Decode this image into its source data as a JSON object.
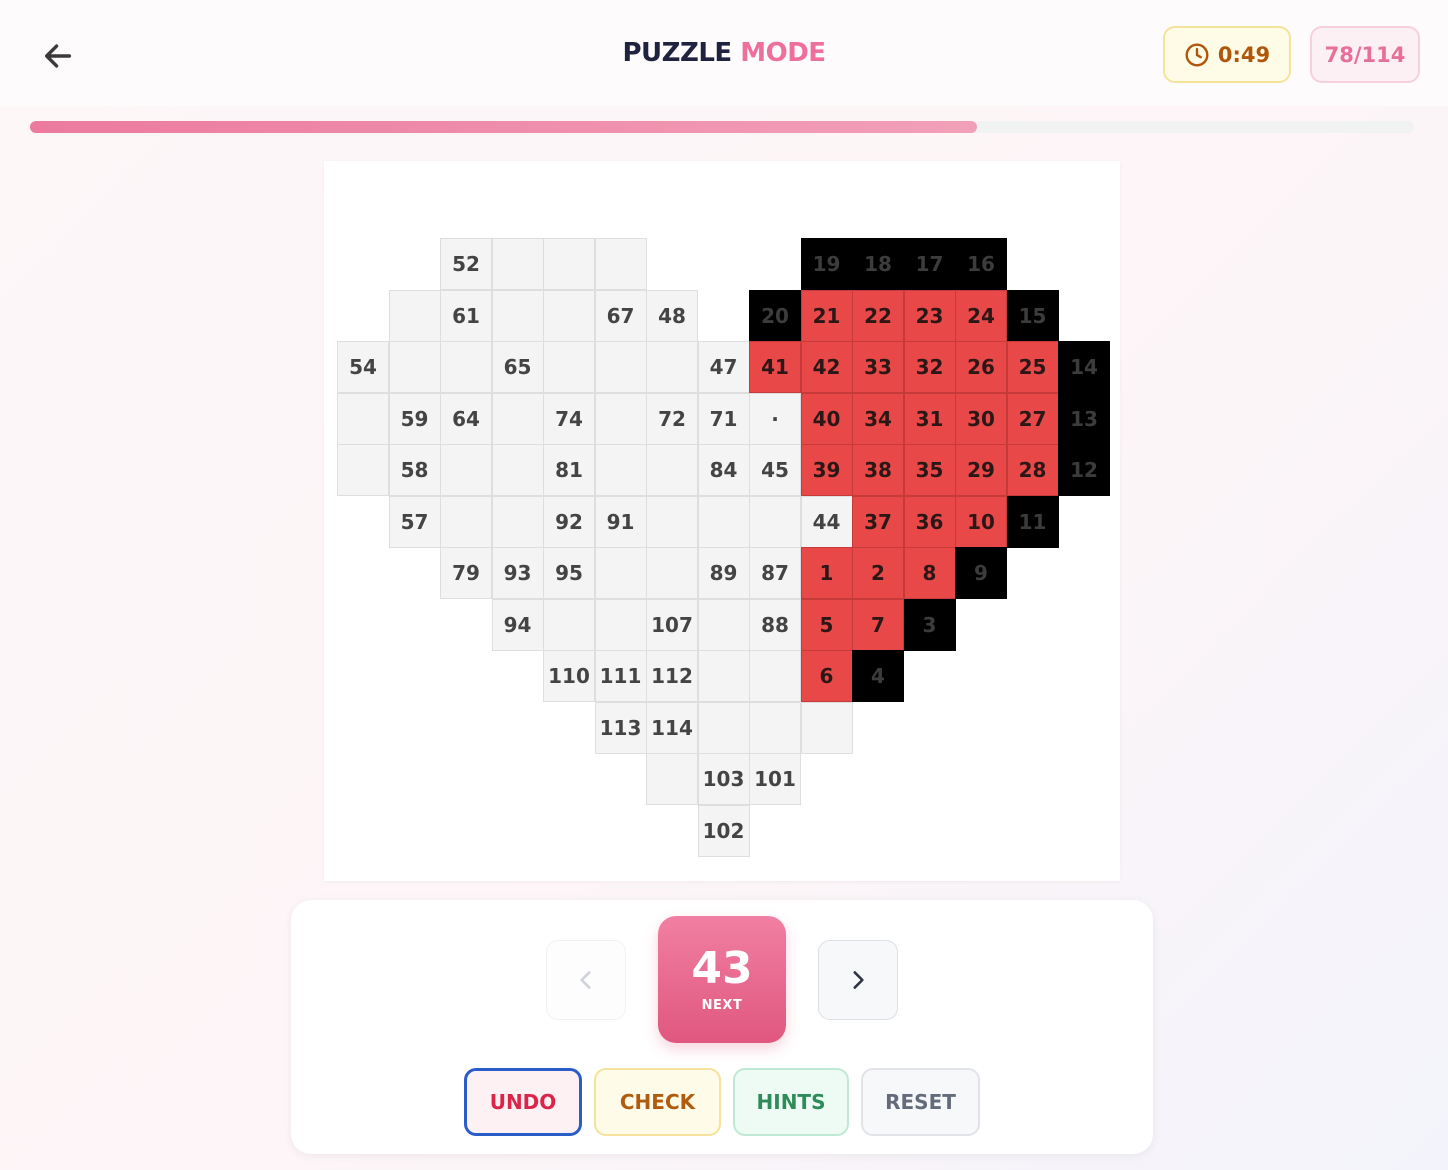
{
  "header": {
    "title_part1": "PUZZLE",
    "title_part2": "MODE",
    "timer": "0:49",
    "counter": "78/114",
    "progress_fraction": 0.684
  },
  "colors": {
    "red": "#e84848",
    "black": "#000000",
    "empty": "#f4f4f4",
    "accent": "#ee6f9b"
  },
  "board": {
    "cells": [
      {
        "r": 0,
        "c": 2,
        "t": "52",
        "s": "e"
      },
      {
        "r": 0,
        "c": 3,
        "t": "",
        "s": "e"
      },
      {
        "r": 0,
        "c": 4,
        "t": "",
        "s": "e"
      },
      {
        "r": 0,
        "c": 5,
        "t": "",
        "s": "e"
      },
      {
        "r": 0,
        "c": 9,
        "t": "19",
        "s": "b"
      },
      {
        "r": 0,
        "c": 10,
        "t": "18",
        "s": "b"
      },
      {
        "r": 0,
        "c": 11,
        "t": "17",
        "s": "b"
      },
      {
        "r": 0,
        "c": 12,
        "t": "16",
        "s": "b"
      },
      {
        "r": 1,
        "c": 1,
        "t": "",
        "s": "e"
      },
      {
        "r": 1,
        "c": 2,
        "t": "61",
        "s": "e"
      },
      {
        "r": 1,
        "c": 3,
        "t": "",
        "s": "e"
      },
      {
        "r": 1,
        "c": 4,
        "t": "",
        "s": "e"
      },
      {
        "r": 1,
        "c": 5,
        "t": "67",
        "s": "e"
      },
      {
        "r": 1,
        "c": 6,
        "t": "48",
        "s": "e"
      },
      {
        "r": 1,
        "c": 8,
        "t": "20",
        "s": "b"
      },
      {
        "r": 1,
        "c": 9,
        "t": "21",
        "s": "r"
      },
      {
        "r": 1,
        "c": 10,
        "t": "22",
        "s": "r"
      },
      {
        "r": 1,
        "c": 11,
        "t": "23",
        "s": "r"
      },
      {
        "r": 1,
        "c": 12,
        "t": "24",
        "s": "r"
      },
      {
        "r": 1,
        "c": 13,
        "t": "15",
        "s": "b"
      },
      {
        "r": 2,
        "c": 0,
        "t": "54",
        "s": "e"
      },
      {
        "r": 2,
        "c": 1,
        "t": "",
        "s": "e"
      },
      {
        "r": 2,
        "c": 2,
        "t": "",
        "s": "e"
      },
      {
        "r": 2,
        "c": 3,
        "t": "65",
        "s": "e"
      },
      {
        "r": 2,
        "c": 4,
        "t": "",
        "s": "e"
      },
      {
        "r": 2,
        "c": 5,
        "t": "",
        "s": "e"
      },
      {
        "r": 2,
        "c": 6,
        "t": "",
        "s": "e"
      },
      {
        "r": 2,
        "c": 7,
        "t": "47",
        "s": "e"
      },
      {
        "r": 2,
        "c": 8,
        "t": "41",
        "s": "r"
      },
      {
        "r": 2,
        "c": 9,
        "t": "42",
        "s": "r"
      },
      {
        "r": 2,
        "c": 10,
        "t": "33",
        "s": "r"
      },
      {
        "r": 2,
        "c": 11,
        "t": "32",
        "s": "r"
      },
      {
        "r": 2,
        "c": 12,
        "t": "26",
        "s": "r"
      },
      {
        "r": 2,
        "c": 13,
        "t": "25",
        "s": "r"
      },
      {
        "r": 2,
        "c": 14,
        "t": "14",
        "s": "b"
      },
      {
        "r": 3,
        "c": 0,
        "t": "",
        "s": "e"
      },
      {
        "r": 3,
        "c": 1,
        "t": "59",
        "s": "e"
      },
      {
        "r": 3,
        "c": 2,
        "t": "64",
        "s": "e"
      },
      {
        "r": 3,
        "c": 3,
        "t": "",
        "s": "e"
      },
      {
        "r": 3,
        "c": 4,
        "t": "74",
        "s": "e"
      },
      {
        "r": 3,
        "c": 5,
        "t": "",
        "s": "e"
      },
      {
        "r": 3,
        "c": 6,
        "t": "72",
        "s": "e"
      },
      {
        "r": 3,
        "c": 7,
        "t": "71",
        "s": "e"
      },
      {
        "r": 3,
        "c": 8,
        "t": "·",
        "s": "e"
      },
      {
        "r": 3,
        "c": 9,
        "t": "40",
        "s": "r"
      },
      {
        "r": 3,
        "c": 10,
        "t": "34",
        "s": "r"
      },
      {
        "r": 3,
        "c": 11,
        "t": "31",
        "s": "r"
      },
      {
        "r": 3,
        "c": 12,
        "t": "30",
        "s": "r"
      },
      {
        "r": 3,
        "c": 13,
        "t": "27",
        "s": "r"
      },
      {
        "r": 3,
        "c": 14,
        "t": "13",
        "s": "b"
      },
      {
        "r": 4,
        "c": 0,
        "t": "",
        "s": "e"
      },
      {
        "r": 4,
        "c": 1,
        "t": "58",
        "s": "e"
      },
      {
        "r": 4,
        "c": 2,
        "t": "",
        "s": "e"
      },
      {
        "r": 4,
        "c": 3,
        "t": "",
        "s": "e"
      },
      {
        "r": 4,
        "c": 4,
        "t": "81",
        "s": "e"
      },
      {
        "r": 4,
        "c": 5,
        "t": "",
        "s": "e"
      },
      {
        "r": 4,
        "c": 6,
        "t": "",
        "s": "e"
      },
      {
        "r": 4,
        "c": 7,
        "t": "84",
        "s": "e"
      },
      {
        "r": 4,
        "c": 8,
        "t": "45",
        "s": "e"
      },
      {
        "r": 4,
        "c": 9,
        "t": "39",
        "s": "r"
      },
      {
        "r": 4,
        "c": 10,
        "t": "38",
        "s": "r"
      },
      {
        "r": 4,
        "c": 11,
        "t": "35",
        "s": "r"
      },
      {
        "r": 4,
        "c": 12,
        "t": "29",
        "s": "r"
      },
      {
        "r": 4,
        "c": 13,
        "t": "28",
        "s": "r"
      },
      {
        "r": 4,
        "c": 14,
        "t": "12",
        "s": "b"
      },
      {
        "r": 5,
        "c": 1,
        "t": "57",
        "s": "e"
      },
      {
        "r": 5,
        "c": 2,
        "t": "",
        "s": "e"
      },
      {
        "r": 5,
        "c": 3,
        "t": "",
        "s": "e"
      },
      {
        "r": 5,
        "c": 4,
        "t": "92",
        "s": "e"
      },
      {
        "r": 5,
        "c": 5,
        "t": "91",
        "s": "e"
      },
      {
        "r": 5,
        "c": 6,
        "t": "",
        "s": "e"
      },
      {
        "r": 5,
        "c": 7,
        "t": "",
        "s": "e"
      },
      {
        "r": 5,
        "c": 8,
        "t": "",
        "s": "e"
      },
      {
        "r": 5,
        "c": 9,
        "t": "44",
        "s": "e"
      },
      {
        "r": 5,
        "c": 10,
        "t": "37",
        "s": "r"
      },
      {
        "r": 5,
        "c": 11,
        "t": "36",
        "s": "r"
      },
      {
        "r": 5,
        "c": 12,
        "t": "10",
        "s": "r"
      },
      {
        "r": 5,
        "c": 13,
        "t": "11",
        "s": "b"
      },
      {
        "r": 6,
        "c": 2,
        "t": "79",
        "s": "e"
      },
      {
        "r": 6,
        "c": 3,
        "t": "93",
        "s": "e"
      },
      {
        "r": 6,
        "c": 4,
        "t": "95",
        "s": "e"
      },
      {
        "r": 6,
        "c": 5,
        "t": "",
        "s": "e"
      },
      {
        "r": 6,
        "c": 6,
        "t": "",
        "s": "e"
      },
      {
        "r": 6,
        "c": 7,
        "t": "89",
        "s": "e"
      },
      {
        "r": 6,
        "c": 8,
        "t": "87",
        "s": "e"
      },
      {
        "r": 6,
        "c": 9,
        "t": "1",
        "s": "r"
      },
      {
        "r": 6,
        "c": 10,
        "t": "2",
        "s": "r"
      },
      {
        "r": 6,
        "c": 11,
        "t": "8",
        "s": "r"
      },
      {
        "r": 6,
        "c": 12,
        "t": "9",
        "s": "b"
      },
      {
        "r": 7,
        "c": 3,
        "t": "94",
        "s": "e"
      },
      {
        "r": 7,
        "c": 4,
        "t": "",
        "s": "e"
      },
      {
        "r": 7,
        "c": 5,
        "t": "",
        "s": "e"
      },
      {
        "r": 7,
        "c": 6,
        "t": "107",
        "s": "e"
      },
      {
        "r": 7,
        "c": 7,
        "t": "",
        "s": "e"
      },
      {
        "r": 7,
        "c": 8,
        "t": "88",
        "s": "e"
      },
      {
        "r": 7,
        "c": 9,
        "t": "5",
        "s": "r"
      },
      {
        "r": 7,
        "c": 10,
        "t": "7",
        "s": "r"
      },
      {
        "r": 7,
        "c": 11,
        "t": "3",
        "s": "b"
      },
      {
        "r": 8,
        "c": 4,
        "t": "110",
        "s": "e"
      },
      {
        "r": 8,
        "c": 5,
        "t": "111",
        "s": "e"
      },
      {
        "r": 8,
        "c": 6,
        "t": "112",
        "s": "e"
      },
      {
        "r": 8,
        "c": 7,
        "t": "",
        "s": "e"
      },
      {
        "r": 8,
        "c": 8,
        "t": "",
        "s": "e"
      },
      {
        "r": 8,
        "c": 9,
        "t": "6",
        "s": "r"
      },
      {
        "r": 8,
        "c": 10,
        "t": "4",
        "s": "b"
      },
      {
        "r": 9,
        "c": 5,
        "t": "113",
        "s": "e"
      },
      {
        "r": 9,
        "c": 6,
        "t": "114",
        "s": "e"
      },
      {
        "r": 9,
        "c": 7,
        "t": "",
        "s": "e"
      },
      {
        "r": 9,
        "c": 8,
        "t": "",
        "s": "e"
      },
      {
        "r": 9,
        "c": 9,
        "t": "",
        "s": "e"
      },
      {
        "r": 10,
        "c": 6,
        "t": "",
        "s": "e"
      },
      {
        "r": 10,
        "c": 7,
        "t": "103",
        "s": "e"
      },
      {
        "r": 10,
        "c": 8,
        "t": "101",
        "s": "e"
      },
      {
        "r": 11,
        "c": 7,
        "t": "102",
        "s": "e"
      }
    ]
  },
  "controls": {
    "current_number": "43",
    "current_label": "NEXT",
    "undo_label": "UNDO",
    "check_label": "CHECK",
    "hints_label": "HINTS",
    "reset_label": "RESET"
  }
}
